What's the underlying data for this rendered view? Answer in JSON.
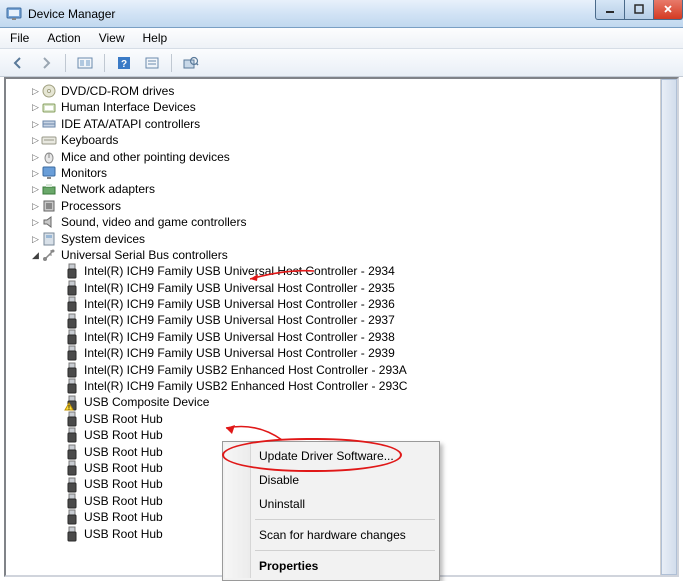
{
  "window": {
    "title": "Device Manager"
  },
  "menu": [
    "File",
    "Action",
    "View",
    "Help"
  ],
  "categories": [
    {
      "label": "DVD/CD-ROM drives",
      "icon": "cd"
    },
    {
      "label": "Human Interface Devices",
      "icon": "hid"
    },
    {
      "label": "IDE ATA/ATAPI controllers",
      "icon": "ide"
    },
    {
      "label": "Keyboards",
      "icon": "kb"
    },
    {
      "label": "Mice and other pointing devices",
      "icon": "mouse"
    },
    {
      "label": "Monitors",
      "icon": "mon"
    },
    {
      "label": "Network adapters",
      "icon": "net"
    },
    {
      "label": "Processors",
      "icon": "cpu"
    },
    {
      "label": "Sound, video and game controllers",
      "icon": "snd"
    },
    {
      "label": "System devices",
      "icon": "sys"
    }
  ],
  "usbCategory": {
    "label": "Universal Serial Bus controllers"
  },
  "usbItems": [
    "Intel(R) ICH9 Family USB Universal Host Controller - 2934",
    "Intel(R) ICH9 Family USB Universal Host Controller - 2935",
    "Intel(R) ICH9 Family USB Universal Host Controller - 2936",
    "Intel(R) ICH9 Family USB Universal Host Controller - 2937",
    "Intel(R) ICH9 Family USB Universal Host Controller - 2938",
    "Intel(R) ICH9 Family USB Universal Host Controller - 2939",
    "Intel(R) ICH9 Family USB2 Enhanced Host Controller - 293A",
    "Intel(R) ICH9 Family USB2 Enhanced Host Controller - 293C",
    "USB Composite Device",
    "USB Root Hub",
    "USB Root Hub",
    "USB Root Hub",
    "USB Root Hub",
    "USB Root Hub",
    "USB Root Hub",
    "USB Root Hub",
    "USB Root Hub"
  ],
  "compositeWarnIndex": 8,
  "contextMenu": {
    "items": [
      {
        "label": "Update Driver Software...",
        "bold": false
      },
      {
        "label": "Disable",
        "bold": false
      },
      {
        "label": "Uninstall",
        "bold": false
      },
      {
        "sep": true
      },
      {
        "label": "Scan for hardware changes",
        "bold": false
      },
      {
        "sep": true
      },
      {
        "label": "Properties",
        "bold": true
      }
    ]
  }
}
